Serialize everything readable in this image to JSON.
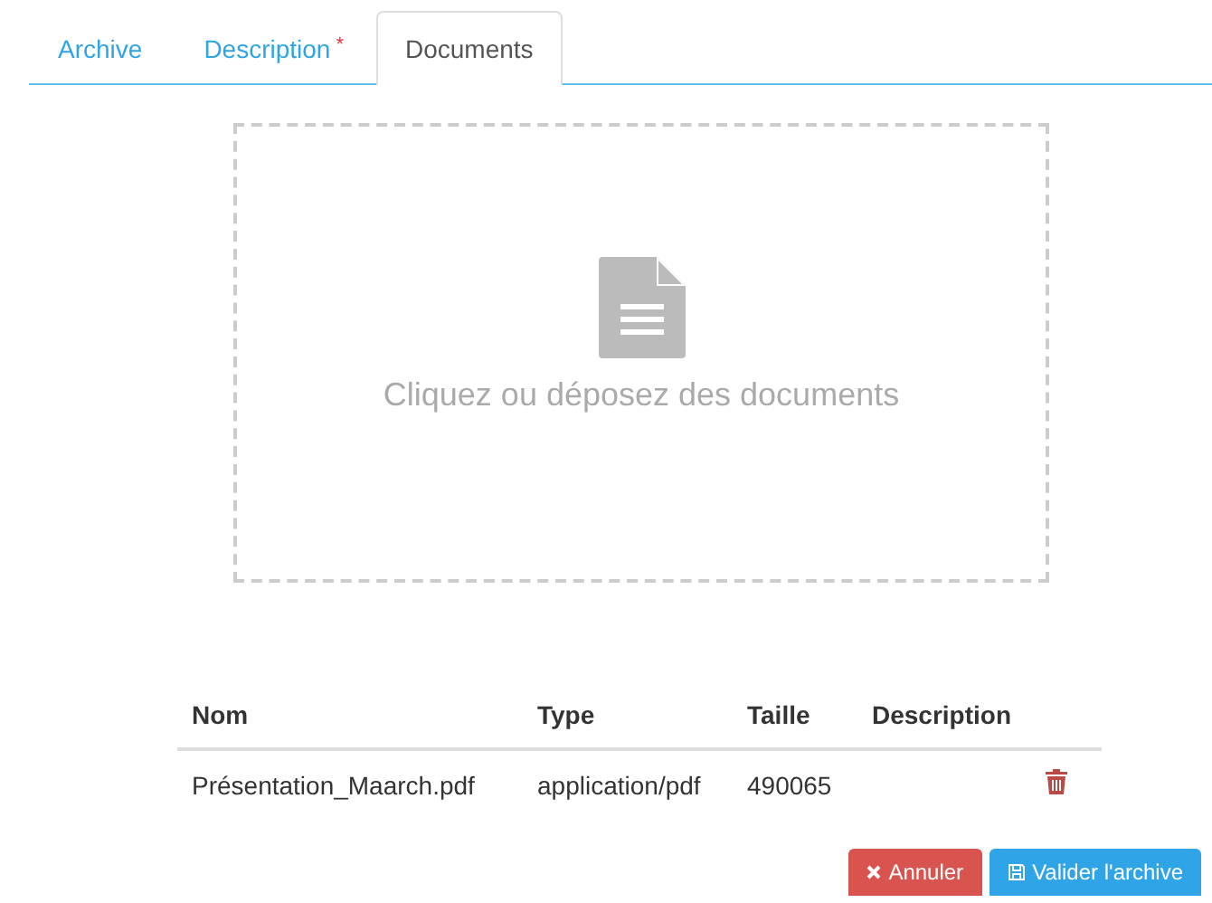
{
  "tabs": [
    {
      "label": "Archive",
      "selected": false
    },
    {
      "label": "Description",
      "selected": false,
      "marker": "*"
    },
    {
      "label": "Documents",
      "selected": true
    }
  ],
  "dropzone": {
    "text": "Cliquez ou déposez des documents"
  },
  "table": {
    "columns": [
      "Nom",
      "Type",
      "Taille",
      "Description"
    ],
    "rows": [
      {
        "cells": [
          "Présentation_Maarch.pdf",
          "application/pdf",
          "490065",
          ""
        ]
      }
    ]
  },
  "buttons": [
    {
      "kind": "cancel",
      "label": "Annuler"
    },
    {
      "kind": "save",
      "label": "Valider l'archive"
    }
  ]
}
